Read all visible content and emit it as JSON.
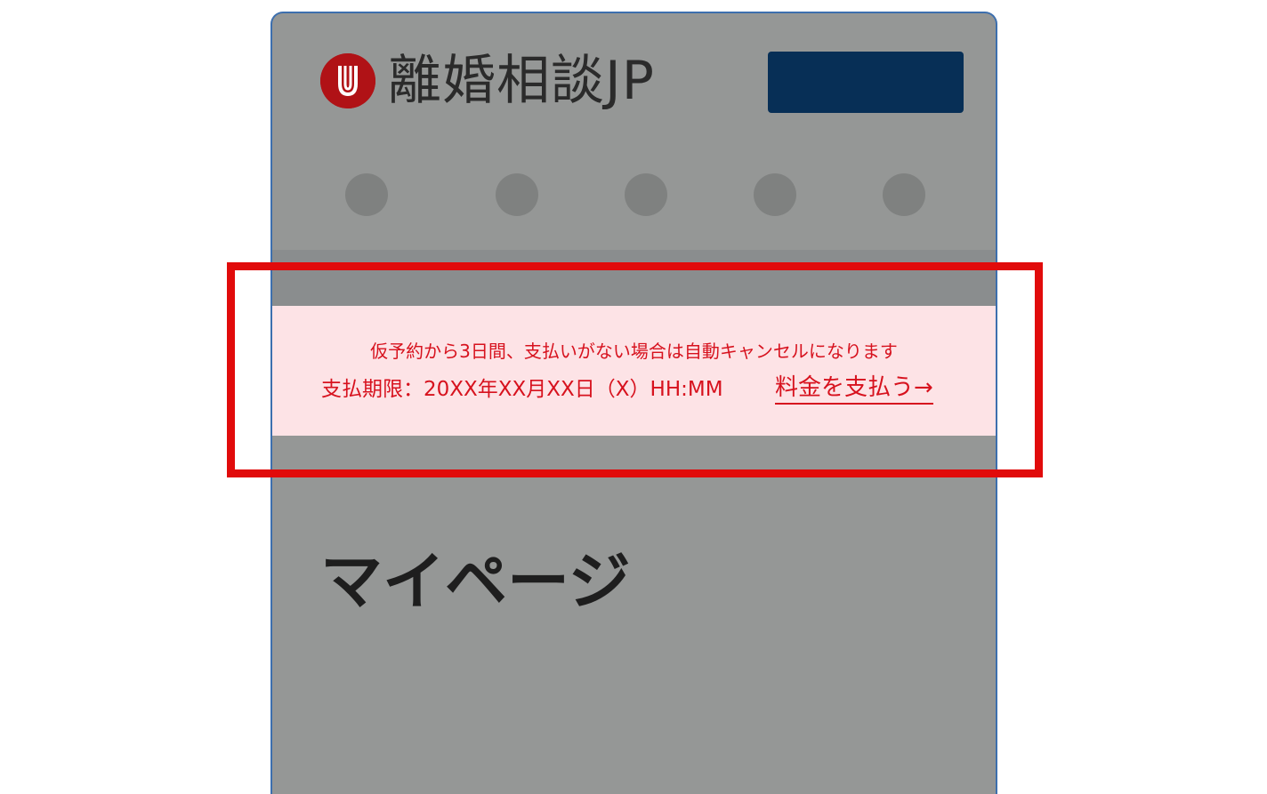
{
  "header": {
    "logo_icon": "j-circle-logo-icon",
    "logo_text": "離婚相談JP",
    "brand_color": "#b01216",
    "button_color": "#072f56"
  },
  "nav": {
    "dot_count": 5
  },
  "notice": {
    "line1": "仮予約から3日間、支払いがない場合は自動キャンセルになります",
    "deadline": "支払期限：20XX年XX月XX日（X）HH:MM",
    "pay_link": "料金を支払う→",
    "text_color": "#d7121e",
    "background_color": "#fde3e6"
  },
  "main": {
    "page_title": "マイページ"
  },
  "annotation": {
    "highlight_color": "#e10b0b"
  }
}
